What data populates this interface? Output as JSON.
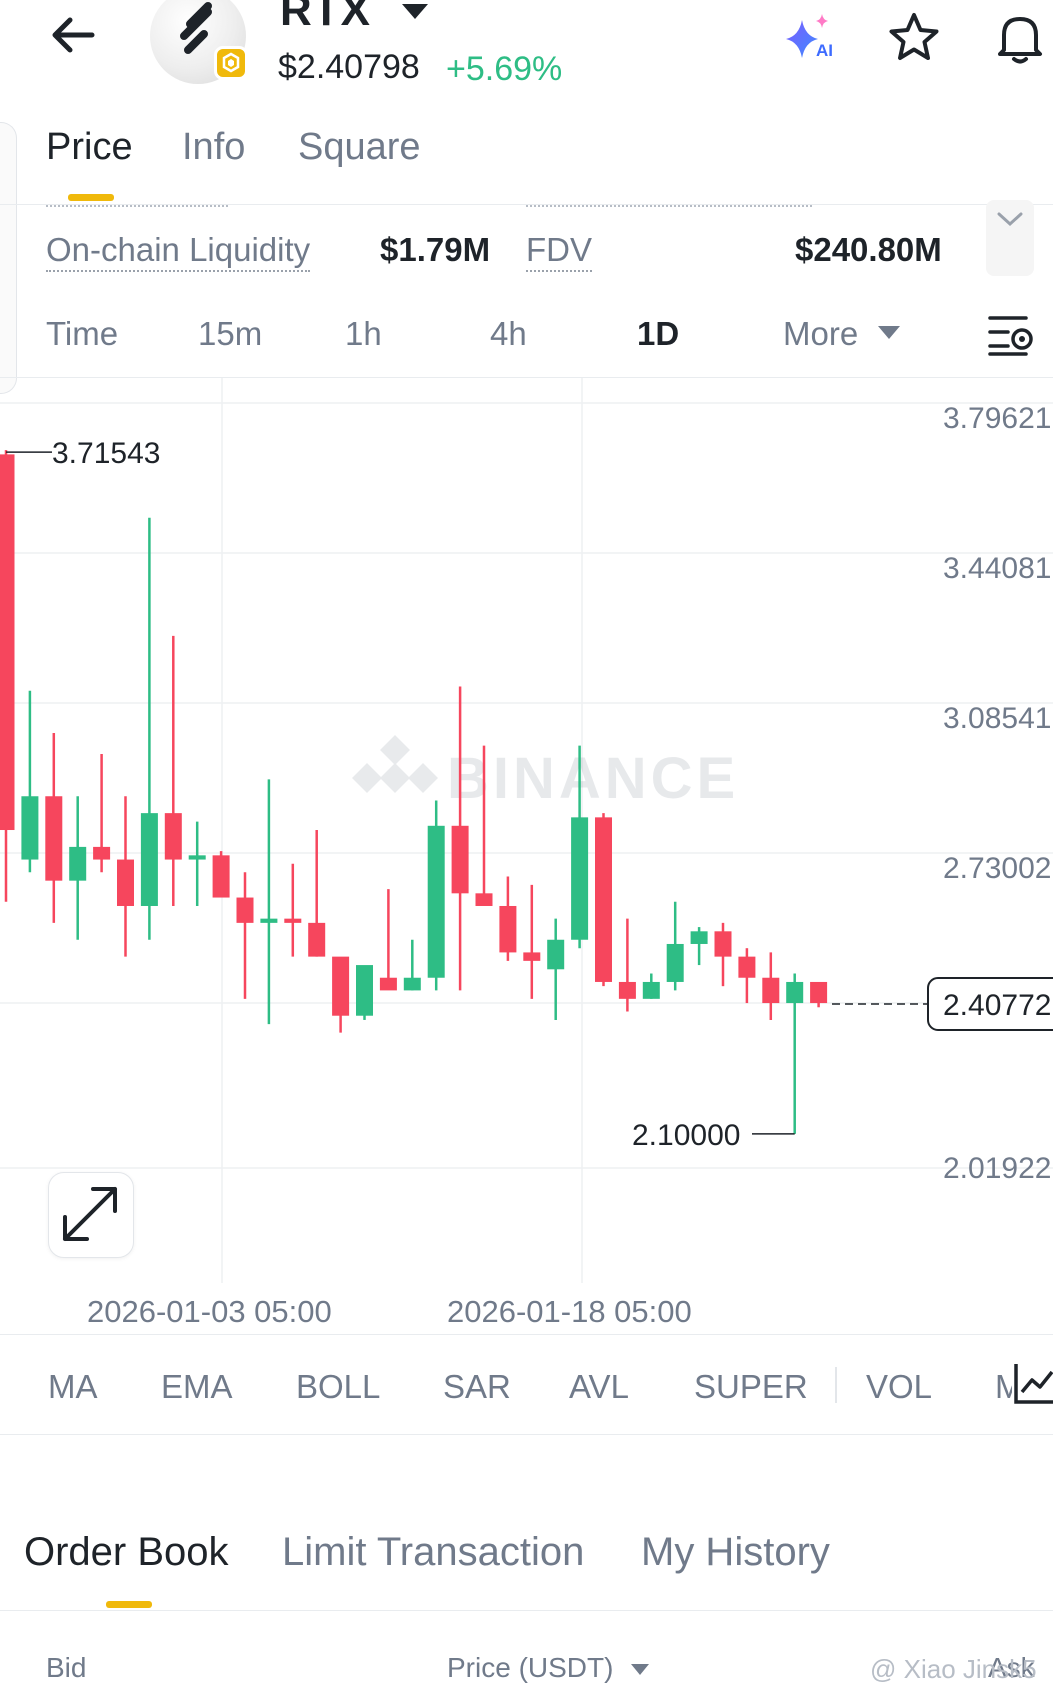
{
  "header": {
    "symbol": "RTX",
    "price": "$2.40798",
    "change": "+5.69%"
  },
  "tabs": [
    "Price",
    "Info",
    "Square"
  ],
  "stats": {
    "liquidity_label": "On-chain Liquidity",
    "liquidity_value": "$1.79M",
    "fdv_label": "FDV",
    "fdv_value": "$240.80M"
  },
  "intervals": [
    "Time",
    "15m",
    "1h",
    "4h",
    "1D",
    "More"
  ],
  "active_interval": "1D",
  "chart_data": {
    "type": "candlestick",
    "y_axis_ticks": [
      "3.79621",
      "3.44081",
      "3.08541",
      "2.73002",
      "2.40772",
      "2.01922"
    ],
    "y_range": [
      2.0192,
      3.7962
    ],
    "high_marker": "3.71543",
    "low_marker": "2.10000",
    "current_price_label": "2.40772",
    "current_price": 2.4077,
    "x_tick_labels": [
      "2026-01-03 05:00",
      "2026-01-18 05:00"
    ],
    "watermark": "BINANCE",
    "candles": [
      {
        "o": 3.71,
        "h": 3.72,
        "l": 2.65,
        "c": 2.82
      },
      {
        "o": 2.75,
        "h": 3.15,
        "l": 2.72,
        "c": 2.9
      },
      {
        "o": 2.9,
        "h": 3.05,
        "l": 2.6,
        "c": 2.7
      },
      {
        "o": 2.7,
        "h": 2.9,
        "l": 2.56,
        "c": 2.78
      },
      {
        "o": 2.78,
        "h": 3.0,
        "l": 2.72,
        "c": 2.75
      },
      {
        "o": 2.75,
        "h": 2.9,
        "l": 2.52,
        "c": 2.64
      },
      {
        "o": 2.64,
        "h": 3.56,
        "l": 2.56,
        "c": 2.86
      },
      {
        "o": 2.86,
        "h": 3.28,
        "l": 2.64,
        "c": 2.75
      },
      {
        "o": 2.75,
        "h": 2.84,
        "l": 2.64,
        "c": 2.76
      },
      {
        "o": 2.76,
        "h": 2.77,
        "l": 2.68,
        "c": 2.66
      },
      {
        "o": 2.66,
        "h": 2.72,
        "l": 2.42,
        "c": 2.6
      },
      {
        "o": 2.6,
        "h": 2.94,
        "l": 2.36,
        "c": 2.61
      },
      {
        "o": 2.61,
        "h": 2.74,
        "l": 2.52,
        "c": 2.6
      },
      {
        "o": 2.6,
        "h": 2.82,
        "l": 2.52,
        "c": 2.52
      },
      {
        "o": 2.52,
        "h": 2.51,
        "l": 2.34,
        "c": 2.38
      },
      {
        "o": 2.38,
        "h": 2.49,
        "l": 2.37,
        "c": 2.5
      },
      {
        "o": 2.47,
        "h": 2.68,
        "l": 2.45,
        "c": 2.44
      },
      {
        "o": 2.44,
        "h": 2.56,
        "l": 2.44,
        "c": 2.47
      },
      {
        "o": 2.47,
        "h": 2.89,
        "l": 2.44,
        "c": 2.83
      },
      {
        "o": 2.83,
        "h": 3.16,
        "l": 2.44,
        "c": 2.67
      },
      {
        "o": 2.67,
        "h": 3.02,
        "l": 2.65,
        "c": 2.64
      },
      {
        "o": 2.64,
        "h": 2.71,
        "l": 2.51,
        "c": 2.53
      },
      {
        "o": 2.53,
        "h": 2.69,
        "l": 2.42,
        "c": 2.51
      },
      {
        "o": 2.49,
        "h": 2.61,
        "l": 2.37,
        "c": 2.56
      },
      {
        "o": 2.56,
        "h": 3.02,
        "l": 2.54,
        "c": 2.85
      },
      {
        "o": 2.85,
        "h": 2.86,
        "l": 2.45,
        "c": 2.46
      },
      {
        "o": 2.46,
        "h": 2.61,
        "l": 2.39,
        "c": 2.42
      },
      {
        "o": 2.42,
        "h": 2.48,
        "l": 2.42,
        "c": 2.46
      },
      {
        "o": 2.46,
        "h": 2.65,
        "l": 2.44,
        "c": 2.55
      },
      {
        "o": 2.55,
        "h": 2.59,
        "l": 2.5,
        "c": 2.58
      },
      {
        "o": 2.58,
        "h": 2.6,
        "l": 2.45,
        "c": 2.52
      },
      {
        "o": 2.52,
        "h": 2.54,
        "l": 2.41,
        "c": 2.47
      },
      {
        "o": 2.47,
        "h": 2.53,
        "l": 2.37,
        "c": 2.41
      },
      {
        "o": 2.41,
        "h": 2.48,
        "l": 2.1,
        "c": 2.46
      },
      {
        "o": 2.46,
        "h": 2.44,
        "l": 2.4,
        "c": 2.41
      }
    ]
  },
  "indicators": [
    "MA",
    "EMA",
    "BOLL",
    "SAR",
    "AVL",
    "SUPER",
    "VOL",
    "M"
  ],
  "bottom_tabs": [
    "Order Book",
    "Limit Transaction",
    "My History"
  ],
  "order_book_columns": {
    "bid": "Bid",
    "price": "Price (USDT)",
    "ask": "Ask"
  },
  "watermark_user": "@ Xiao Jinsk5",
  "colors": {
    "up": "#2EBD85",
    "down": "#F6465D",
    "accent": "#F0B90B"
  }
}
